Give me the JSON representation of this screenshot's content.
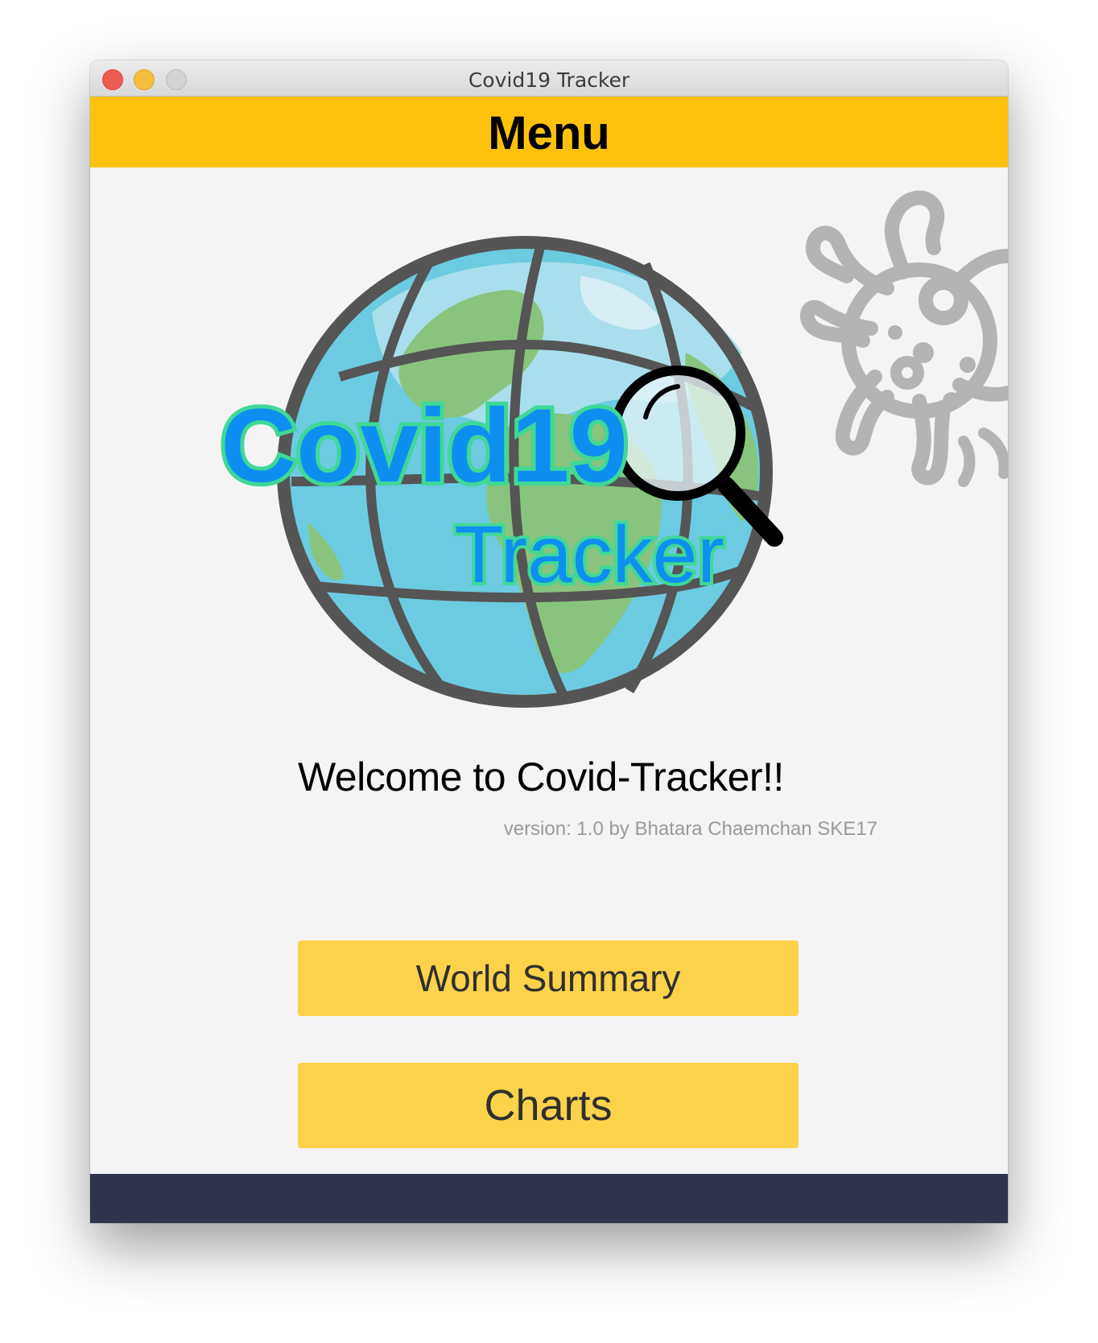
{
  "window": {
    "title": "Covid19 Tracker"
  },
  "menu": {
    "title": "Menu"
  },
  "logo": {
    "line1": "Covid19",
    "line2": "Tracker"
  },
  "welcome": {
    "heading": "Welcome to Covid-Tracker!!",
    "version": "version: 1.0 by Bhatara Chaemchan SKE17"
  },
  "buttons": {
    "world_summary": "World Summary",
    "charts": "Charts"
  },
  "colors": {
    "menu_bar": "#fec20c",
    "button": "#fdd24b",
    "footer": "#2d344b",
    "logo_text": "#0d8ff2",
    "logo_outline": "#3fd897"
  },
  "icons": [
    "close-icon",
    "minimize-icon",
    "maximize-icon",
    "globe-icon",
    "magnifier-icon",
    "virus-icon"
  ]
}
